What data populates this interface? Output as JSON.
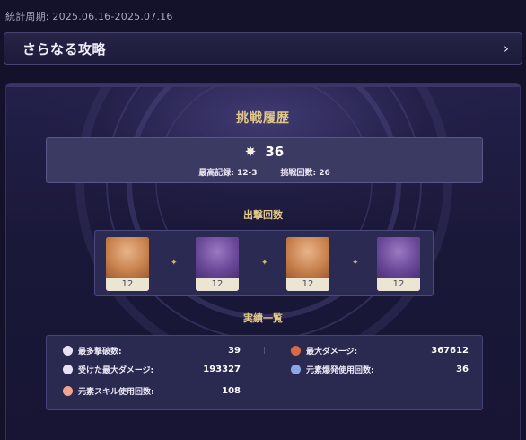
{
  "period": "統計周期: 2025.06.16-2025.07.16",
  "more": {
    "title": "さらなる攻略",
    "arrow_icon": "chevron-right-icon"
  },
  "history": {
    "title": "挑戦履歴",
    "score": "36",
    "best_record": "最高記録: 12-3",
    "challenge_count": "挑戦回数: 26"
  },
  "deployments": {
    "title": "出撃回数",
    "characters": [
      {
        "count": "12"
      },
      {
        "count": "12"
      },
      {
        "count": "12"
      },
      {
        "count": "12"
      }
    ]
  },
  "achievements": {
    "title": "実績一覧",
    "left": [
      {
        "label": "最多撃破数:",
        "value": "39"
      },
      {
        "label": "受けた最大ダメージ:",
        "value": "193327"
      },
      {
        "label": "元素スキル使用回数:",
        "value": "108"
      }
    ],
    "right": [
      {
        "label": "最大ダメージ:",
        "value": "367612"
      },
      {
        "label": "元素爆発使用回数:",
        "value": "36"
      }
    ]
  },
  "colors": {
    "accent_gold": "#e2c888",
    "background": "#14122a",
    "panel": "#2a2950"
  }
}
